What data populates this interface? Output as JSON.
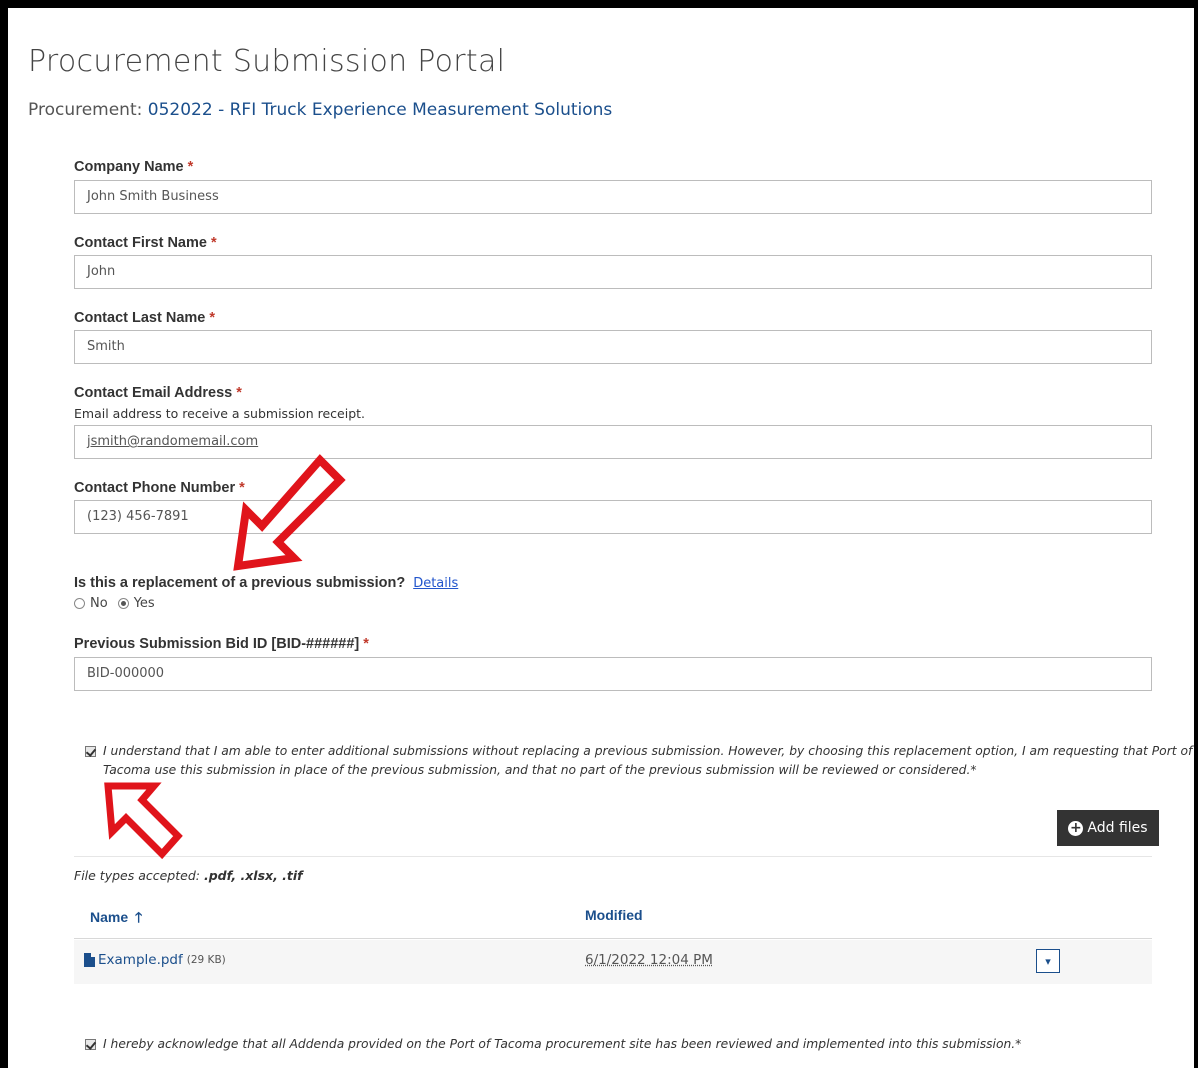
{
  "page": {
    "title": "Procurement Submission Portal",
    "procurement_label": "Procurement:",
    "procurement_value": "052022 - RFI Truck Experience Measurement Solutions"
  },
  "form": {
    "required_marker": "*",
    "company_name": {
      "label": "Company Name",
      "value": "John Smith Business"
    },
    "first_name": {
      "label": "Contact First Name",
      "value": "John"
    },
    "last_name": {
      "label": "Contact Last Name",
      "value": "Smith"
    },
    "email": {
      "label": "Contact Email Address",
      "description": "Email address to receive a submission receipt.",
      "value": "jsmith@randomemail.com"
    },
    "phone": {
      "label": "Contact Phone Number",
      "value": "(123) 456-7891"
    },
    "replacement": {
      "question": "Is this a replacement of a previous submission?",
      "details_link": "Details",
      "options": [
        "No",
        "Yes"
      ],
      "selected": "Yes"
    },
    "prev_bid": {
      "label": "Previous Submission Bid ID [BID-######]",
      "value": "BID-000000"
    },
    "understand_check": {
      "checked": true,
      "line1": "I understand that I am able to enter additional submissions without replacing a previous submission. However, by choosing this replacement option, I am requesting that Port of",
      "line2": "Tacoma use this submission in place of the previous submission, and that no part of the previous submission will be reviewed or considered.*"
    },
    "add_files_label": "Add files",
    "file_types_prefix": "File types accepted:",
    "file_types_value": ".pdf, .xlsx, .tif",
    "table": {
      "col_name": "Name",
      "col_modified": "Modified",
      "rows": [
        {
          "name": "Example.pdf",
          "size": "(29 KB)",
          "modified": "6/1/2022 12:04 PM"
        }
      ]
    },
    "acknowledge_check": {
      "checked": true,
      "text": "I hereby acknowledge that all Addenda provided on the Port of Tacoma procurement site has been reviewed and implemented into this submission.*"
    }
  },
  "colors": {
    "link": "#1b4f8c",
    "required": "#c0392b",
    "arrow": "#e0141b",
    "button": "#333333"
  }
}
